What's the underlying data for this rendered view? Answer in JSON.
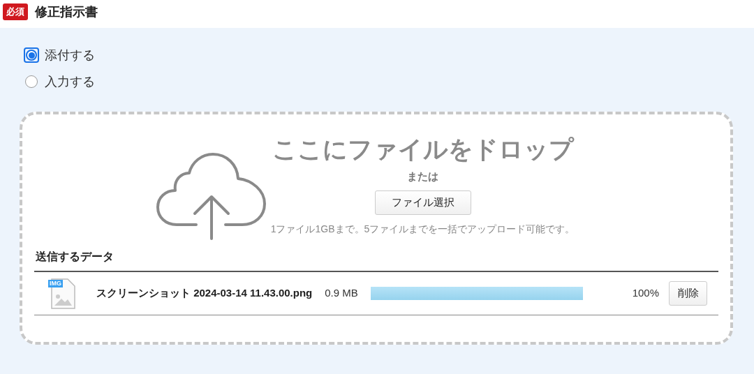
{
  "header": {
    "badge": "必須",
    "title": "修正指示書"
  },
  "options": [
    {
      "label": "添付する",
      "selected": true
    },
    {
      "label": "入力する",
      "selected": false
    }
  ],
  "dropzone": {
    "title": "ここにファイルをドロップ",
    "or": "または",
    "button": "ファイル選択",
    "note": "1ファイル1GBまで。5ファイルまでを一括でアップロード可能です。"
  },
  "files_section": {
    "title": "送信するデータ",
    "files": [
      {
        "icon_label": "IMG",
        "name": "スクリーンショット 2024-03-14 11.43.00.png",
        "size": "0.9 MB",
        "level": 1,
        "percent": "100%",
        "delete": "削除"
      }
    ]
  }
}
